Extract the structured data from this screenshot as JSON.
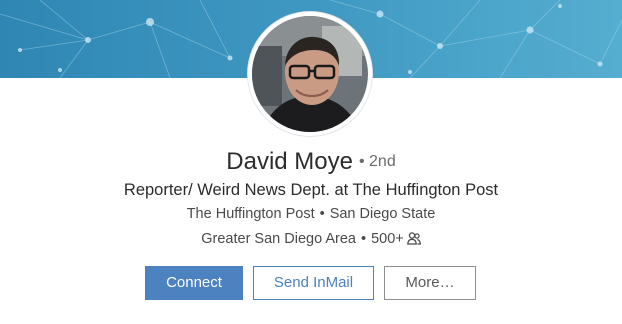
{
  "profile": {
    "name": "David Moye",
    "degree": "• 2nd",
    "headline": "Reporter/ Weird News Dept. at The Huffington Post",
    "company": "The Huffington Post",
    "school": "San Diego State",
    "location": "Greater San Diego Area",
    "connections": "500+",
    "separator": "•"
  },
  "actions": {
    "connect_label": "Connect",
    "inmail_label": "Send InMail",
    "more_label": "More…"
  },
  "icons": {
    "connections": "people-icon"
  },
  "colors": {
    "banner_top": "#2f86b3",
    "banner_bottom": "#55aed0",
    "primary": "#4b82bf",
    "text": "#2c2c2c"
  }
}
